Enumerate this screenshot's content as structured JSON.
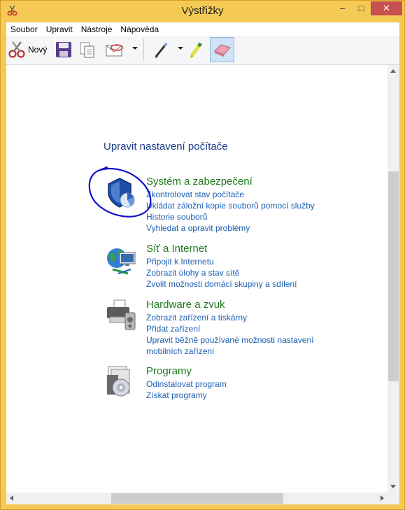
{
  "window": {
    "title": "Výstřižky",
    "minimize": "–",
    "maximize": "□",
    "close": "✕"
  },
  "menu": [
    "Soubor",
    "Upravit",
    "Nástroje",
    "Nápověda"
  ],
  "toolbar": {
    "new_label": "Nový",
    "icons": [
      "scissors-icon",
      "save-icon",
      "copy-icon",
      "send-icon",
      "pen-icon",
      "highlighter-icon",
      "eraser-icon"
    ]
  },
  "content": {
    "heading": "Upravit nastavení počítače",
    "categories": [
      {
        "title": "Systém a zabezpečení",
        "icon": "shield-icon",
        "links": [
          "Zkontrolovat stav počítače",
          "Ukládat záložní kopie souborů pomocí služby",
          "Historie souborů",
          "Vyhledat a opravit problémy"
        ]
      },
      {
        "title": "Síť a Internet",
        "icon": "network-globe-icon",
        "links": [
          "Připojit k Internetu",
          "Zobrazit úlohy a stav sítě",
          "Zvolit možnosti domácí skupiny a sdílení"
        ]
      },
      {
        "title": "Hardware a zvuk",
        "icon": "printer-speaker-icon",
        "links": [
          "Zobrazit zařízení a tiskárny",
          "Přidat zařízení",
          "Upravit běžně používané možnosti nastavení",
          "mobilních zařízení"
        ]
      },
      {
        "title": "Programy",
        "icon": "programs-disc-icon",
        "links": [
          "Odinstalovat program",
          "Získat programy"
        ]
      }
    ]
  },
  "colors": {
    "frame": "#f5ca54",
    "heading": "#1e3c8c",
    "category_title": "#1e7a1e",
    "link": "#1a5fb4",
    "annotation": "#1010c8",
    "close_button": "#c75050"
  }
}
